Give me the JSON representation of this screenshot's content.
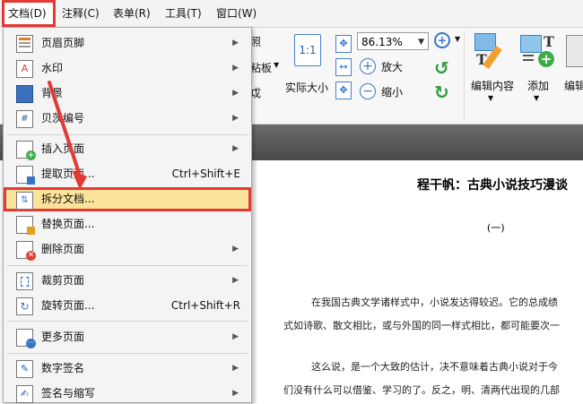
{
  "menubar": {
    "items": [
      "文档(D)",
      "注释(C)",
      "表单(R)",
      "工具(T)",
      "窗口(W)"
    ]
  },
  "ribbon": {
    "partial_label_1": "照",
    "partial_label_2": "粘板",
    "partial_label_3": "戉",
    "actual_size_label": "实际大小",
    "actual_size_icon_text": "1:1",
    "zoom_value": "86.13%",
    "zoom_in_label": "放大",
    "zoom_out_label": "缩小",
    "edit_content_label": "编辑内容",
    "add_label": "添加",
    "edit_partial_label": "编辑"
  },
  "document": {
    "title": "程干帆：古典小说技巧漫谈",
    "section": "(一)",
    "lines": [
      "在我国古典文学诸样式中，小说发达得较迟。它的总成绩",
      "式如诗歌、散文相比，或与外国的同一样式相比，都可能要次一",
      "这么说，是一个大致的估计，决不意味着古典小说对于今",
      "们没有什么可以借鉴、学习的了。反之，明、清两代出现的几部"
    ]
  },
  "menu": {
    "items": [
      {
        "label": "页眉页脚",
        "shortcut": "",
        "submenu": true,
        "icon": "header-footer-icon"
      },
      {
        "label": "水印",
        "shortcut": "",
        "submenu": true,
        "icon": "watermark-icon"
      },
      {
        "label": "背景",
        "shortcut": "",
        "submenu": true,
        "icon": "background-icon"
      },
      {
        "label": "贝茨编号",
        "shortcut": "",
        "submenu": true,
        "icon": "bates-number-icon"
      },
      {
        "label": "插入页面",
        "shortcut": "",
        "submenu": true,
        "icon": "insert-page-icon"
      },
      {
        "label": "提取页面...",
        "shortcut": "Ctrl+Shift+E",
        "submenu": false,
        "icon": "extract-page-icon"
      },
      {
        "label": "拆分文档...",
        "shortcut": "",
        "submenu": false,
        "icon": "split-document-icon"
      },
      {
        "label": "替换页面...",
        "shortcut": "",
        "submenu": false,
        "icon": "replace-page-icon"
      },
      {
        "label": "删除页面",
        "shortcut": "",
        "submenu": true,
        "icon": "delete-page-icon"
      },
      {
        "label": "裁剪页面",
        "shortcut": "",
        "submenu": true,
        "icon": "crop-page-icon"
      },
      {
        "label": "旋转页面...",
        "shortcut": "Ctrl+Shift+R",
        "submenu": false,
        "icon": "rotate-page-icon"
      },
      {
        "label": "更多页面",
        "shortcut": "",
        "submenu": true,
        "icon": "more-pages-icon"
      },
      {
        "label": "数字签名",
        "shortcut": "",
        "submenu": true,
        "icon": "digital-signature-icon"
      },
      {
        "label": "签名与缩写",
        "shortcut": "",
        "submenu": true,
        "icon": "signature-initials-icon"
      }
    ],
    "submenu_arrow": "▶"
  },
  "colors": {
    "highlight_border": "#e53935",
    "highlight_fill": "#fbe39b",
    "annotation_arrow": "#e53935",
    "accent_blue": "#3a74c9"
  }
}
